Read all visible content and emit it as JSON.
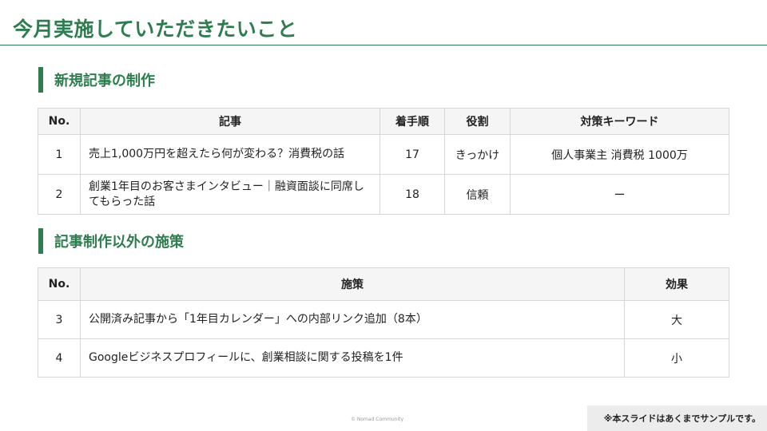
{
  "page": {
    "title": "今月実施していただきたいこと"
  },
  "section1": {
    "heading": "新規記事の制作",
    "columns": [
      "No.",
      "記事",
      "着手順",
      "役割",
      "対策キーワード"
    ],
    "rows": [
      {
        "no": "1",
        "article": "売上1,000万円を超えたら何が変わる？消費税の話",
        "order": "17",
        "role": "きっかけ",
        "keywords": "個人事業主 消費税 1000万"
      },
      {
        "no": "2",
        "article": "創業1年目のお客さまインタビュー｜融資面談に同席してもらった話",
        "order": "18",
        "role": "信頼",
        "keywords": "ー"
      }
    ]
  },
  "section2": {
    "heading": "記事制作以外の施策",
    "columns": [
      "No.",
      "施策",
      "効果"
    ],
    "rows": [
      {
        "no": "3",
        "measure": "公開済み記事から「1年目カレンダー」への内部リンク追加（8本）",
        "effect": "大"
      },
      {
        "no": "4",
        "measure": "Googleビジネスプロフィールに、創業相談に関する投稿を1件",
        "effect": "小"
      }
    ]
  },
  "footer": {
    "copyright": "© Nomad Community",
    "sample_note": "※本スライドはあくまでサンプルです。"
  },
  "colors": {
    "accent": "#2e7d4f",
    "header_bg": "#f4f5f4",
    "border": "#d6d6d6",
    "note_bg": "#ececec"
  }
}
